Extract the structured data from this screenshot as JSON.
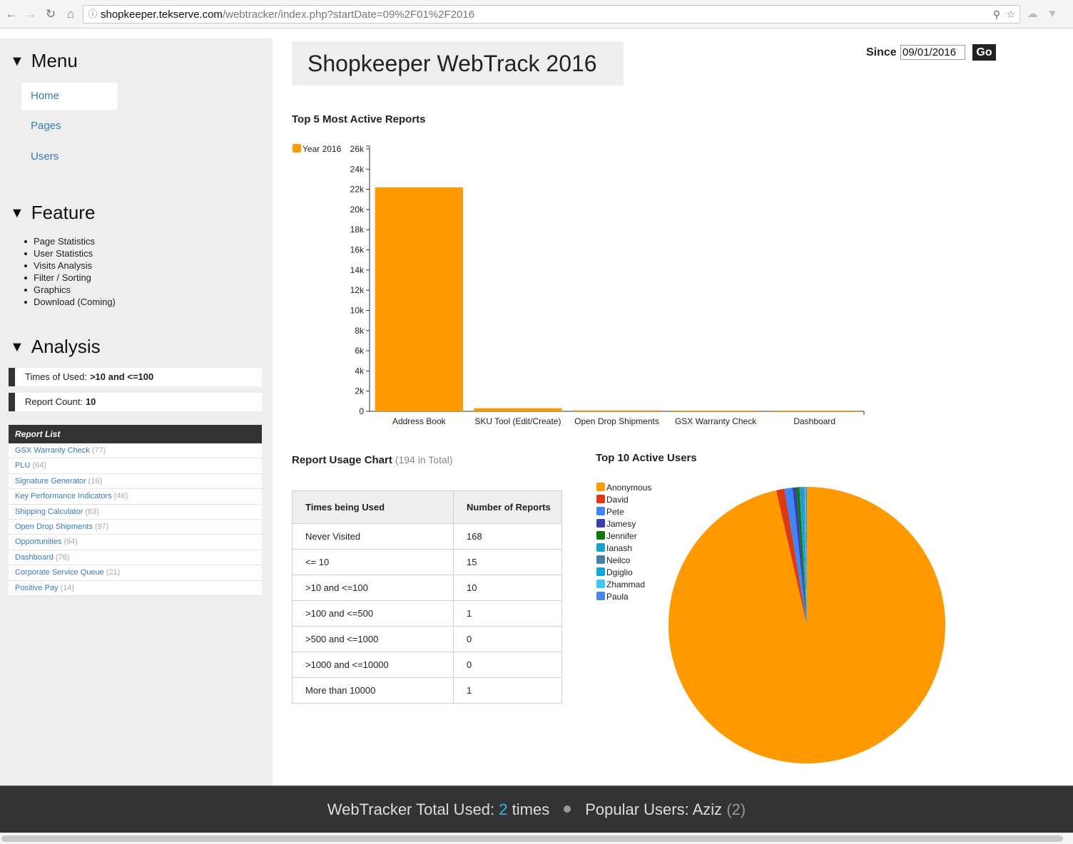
{
  "browser": {
    "url_host": "shopkeeper.tekserve.com",
    "url_path": "/webtracker/index.php?startDate=09%2F01%2F2016"
  },
  "sidebar": {
    "menu_heading": "Menu",
    "menu_items": [
      {
        "label": "Home",
        "active": true
      },
      {
        "label": "Pages",
        "active": false
      },
      {
        "label": "Users",
        "active": false
      }
    ],
    "feature_heading": "Feature",
    "features": [
      "Page Statistics",
      "User Statistics",
      "Visits Analysis",
      "Filter / Sorting",
      "Graphics",
      "Download (Coming)"
    ],
    "analysis_heading": "Analysis",
    "times_of_used_label": "Times of Used:",
    "times_of_used_value": ">10 and <=100",
    "report_count_label": "Report Count:",
    "report_count_value": "10",
    "report_list_title": "Report List",
    "report_list": [
      {
        "name": "GSX Warranty Check",
        "count": "(77)"
      },
      {
        "name": "PLU",
        "count": "(64)"
      },
      {
        "name": "Signature Generator",
        "count": "(16)"
      },
      {
        "name": "Key Performance Indicators",
        "count": "(46)"
      },
      {
        "name": "Shipping Calculator",
        "count": "(63)"
      },
      {
        "name": "Open Drop Shipments",
        "count": "(97)"
      },
      {
        "name": "Opportunities",
        "count": "(64)"
      },
      {
        "name": "Dashboard",
        "count": "(76)"
      },
      {
        "name": "Corporate Service Queue",
        "count": "(21)"
      },
      {
        "name": "Positive Pay",
        "count": "(14)"
      }
    ]
  },
  "header": {
    "title": "Shopkeeper WebTrack 2016",
    "since_label": "Since",
    "since_value": "09/01/2016",
    "go_label": "Go"
  },
  "top_reports": {
    "title": "Top 5 Most Active Reports"
  },
  "usage": {
    "title": "Report Usage Chart",
    "total": "(194 in Total)",
    "headers": [
      "Times being Used",
      "Number of Reports"
    ],
    "rows": [
      [
        "Never Visited",
        "168"
      ],
      [
        "<= 10",
        "15"
      ],
      [
        ">10 and <=100",
        "10"
      ],
      [
        ">100 and <=500",
        "1"
      ],
      [
        ">500 and <=1000",
        "0"
      ],
      [
        ">1000 and <=10000",
        "0"
      ],
      [
        "More than 10000",
        "1"
      ]
    ]
  },
  "top_users": {
    "title": "Top 10 Active Users"
  },
  "footer": {
    "total_used_label": "WebTracker Total Used:",
    "total_used_value": "2",
    "total_used_unit": "times",
    "popular_label": "Popular Users: Aziz",
    "popular_count": "(2)"
  },
  "chart_data": [
    {
      "type": "bar",
      "title": "Top 5 Most Active Reports",
      "categories": [
        "Address Book",
        "SKU Tool (Edit/Create)",
        "Open Drop Shipments",
        "GSX Warranty Check",
        "Dashboard"
      ],
      "series": [
        {
          "name": "Year 2016",
          "color": "#ff9900",
          "values": [
            22200,
            300,
            97,
            77,
            76
          ]
        }
      ],
      "yticks": [
        "0",
        "2k",
        "4k",
        "6k",
        "8k",
        "10k",
        "12k",
        "14k",
        "16k",
        "18k",
        "20k",
        "22k",
        "24k",
        "26k"
      ],
      "ylim": [
        0,
        26000
      ],
      "legend": "top-left",
      "grid": false
    },
    {
      "type": "pie",
      "title": "Top 10 Active Users",
      "legend": "top-left",
      "slices": [
        {
          "label": "Anonymous",
          "value": 2220,
          "color": "#ff9900"
        },
        {
          "label": "David",
          "value": 22,
          "color": "#dc3912"
        },
        {
          "label": "Pete",
          "value": 22,
          "color": "#4285f4"
        },
        {
          "label": "Jamesy",
          "value": 10,
          "color": "#3b3eac"
        },
        {
          "label": "Jennifer",
          "value": 8,
          "color": "#0d7a0d"
        },
        {
          "label": "Ianash",
          "value": 6,
          "color": "#17a2c8"
        },
        {
          "label": "Neilco",
          "value": 4,
          "color": "#4a7fa8"
        },
        {
          "label": "Dgiglio",
          "value": 4,
          "color": "#10a8d8"
        },
        {
          "label": "Zhammad",
          "value": 3,
          "color": "#3cc8f0"
        },
        {
          "label": "Paula",
          "value": 3,
          "color": "#4a86e8"
        }
      ]
    }
  ]
}
